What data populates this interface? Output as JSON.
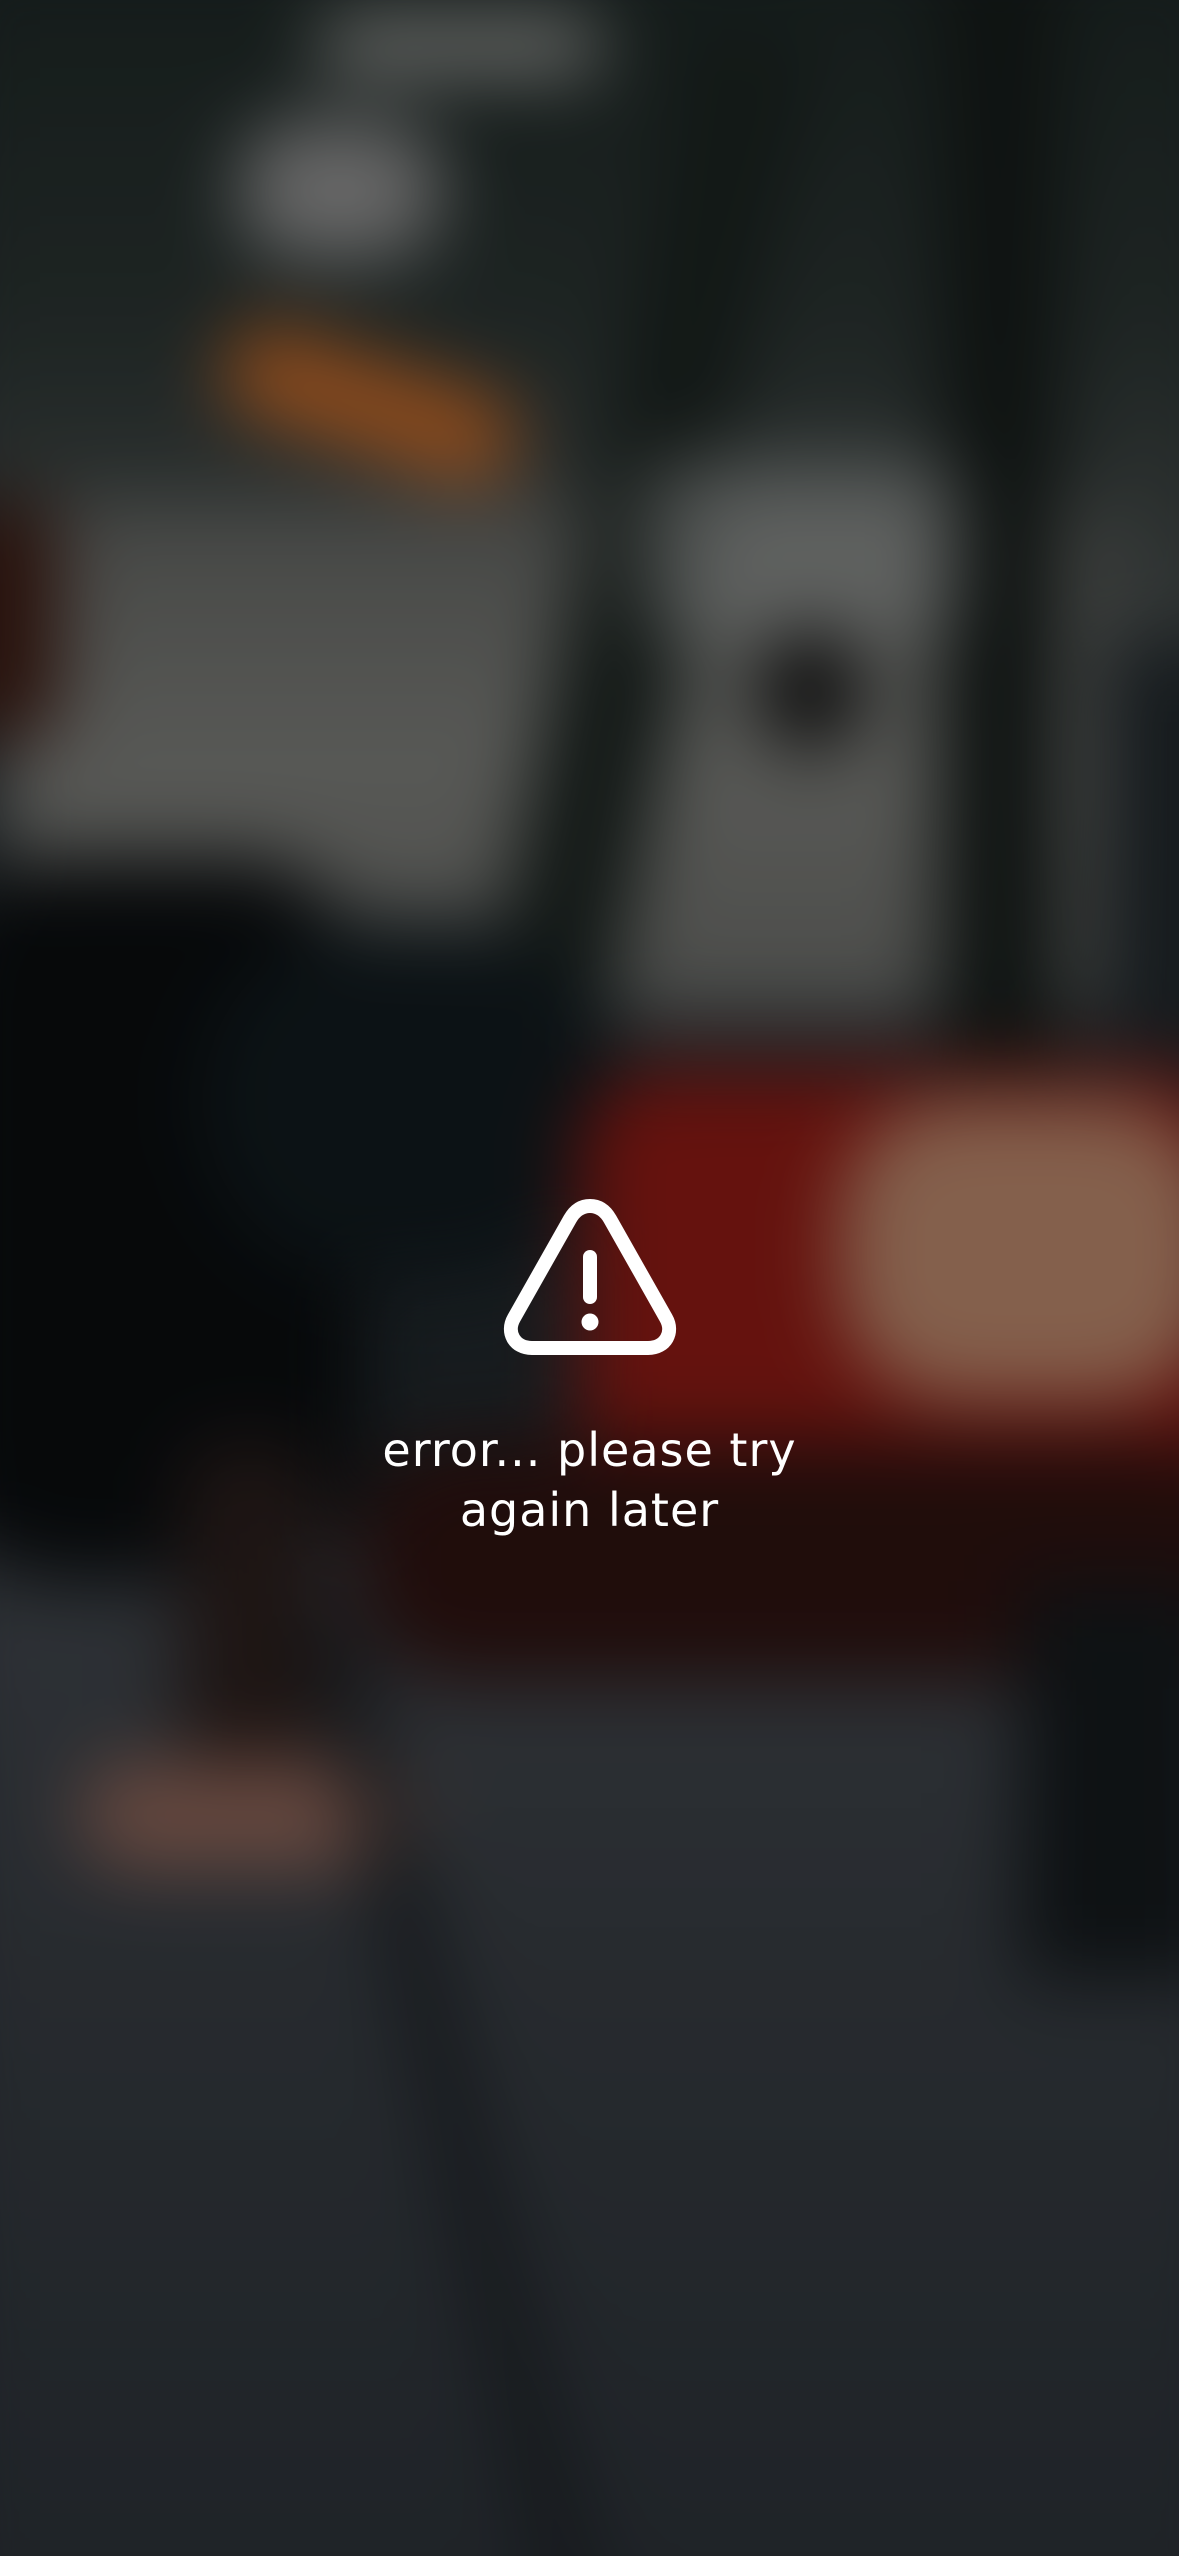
{
  "screen": {
    "background_description_icon": "blurred-background-image"
  },
  "error": {
    "icon": "warning-triangle-icon",
    "icon_color": "#ffffff",
    "message": "error... please try again later"
  }
}
